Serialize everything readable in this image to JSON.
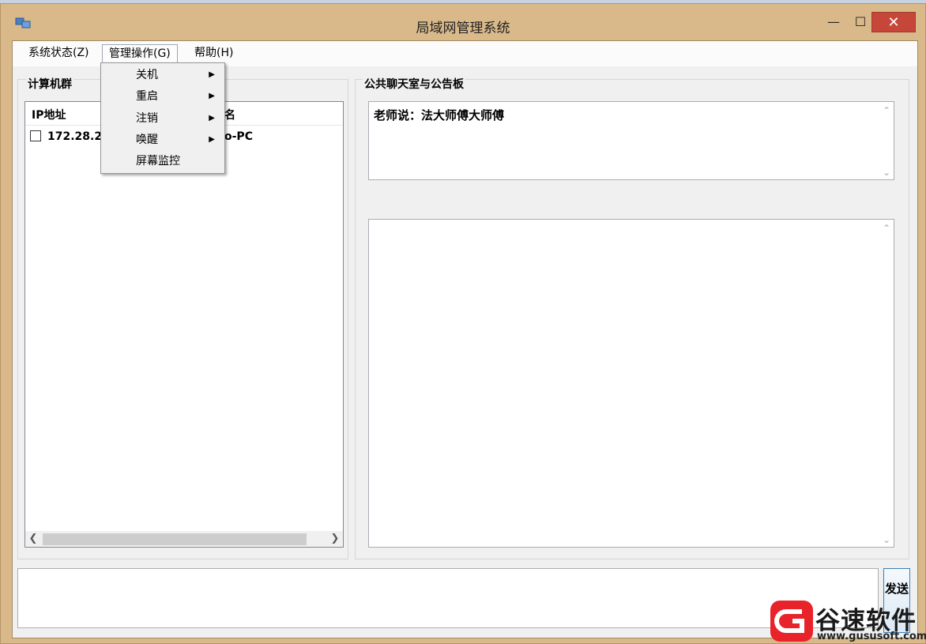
{
  "window": {
    "title": "局域网管理系统",
    "minimize": "—",
    "maximize": "☐",
    "close": "✕"
  },
  "menubar": {
    "items": [
      {
        "label": "系统状态(Z)"
      },
      {
        "label": "管理操作(G)",
        "active": true
      },
      {
        "label": "帮助(H)"
      }
    ]
  },
  "dropdown": {
    "items": [
      {
        "label": "关机",
        "submenu": true
      },
      {
        "label": "重启",
        "submenu": true
      },
      {
        "label": "注销",
        "submenu": true
      },
      {
        "label": "唤醒",
        "submenu": true
      },
      {
        "label": "屏幕监控",
        "submenu": false
      }
    ]
  },
  "computer_group": {
    "title": "计算机群",
    "columns": [
      "IP地址",
      "名"
    ],
    "rows": [
      {
        "ip": "172.28.28",
        "name": "o-PC",
        "checked": false
      }
    ]
  },
  "chat": {
    "title": "公共聊天室与公告板",
    "notice": "老师说：法大师傅大师傅",
    "messages": "",
    "input_value": "",
    "send_label": "发送"
  },
  "watermark": {
    "name": "谷速软件",
    "url": "www.gususoft.com"
  },
  "colors": {
    "window_frame": "#d9b98a",
    "close_button": "#c7463a",
    "client_bg": "#f0f0f0"
  }
}
